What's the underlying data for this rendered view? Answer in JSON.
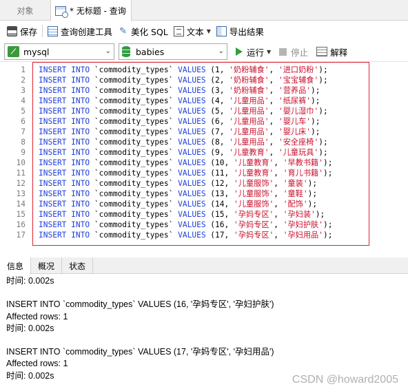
{
  "tabs": {
    "objects_label": "对象",
    "query_label": "* 无标题 - 查询"
  },
  "toolbar": {
    "save": "保存",
    "query_builder": "查询创建工具",
    "beautify_sql": "美化 SQL",
    "text": "文本",
    "export_results": "导出结果"
  },
  "connection": {
    "value": "mysql"
  },
  "database": {
    "value": "babies"
  },
  "actions": {
    "run": "运行",
    "stop": "停止",
    "explain": "解释"
  },
  "editor": {
    "lines": [
      {
        "n": "1",
        "kw1": "INSERT",
        "kw2": "INTO",
        "table": "`commodity_types`",
        "kw3": "VALUES",
        "id": "1",
        "a": "'奶粉辅食'",
        "b": "'进口奶粉'"
      },
      {
        "n": "2",
        "kw1": "INSERT",
        "kw2": "INTO",
        "table": "`commodity_types`",
        "kw3": "VALUES",
        "id": "2",
        "a": "'奶粉辅食'",
        "b": "'宝宝辅食'"
      },
      {
        "n": "3",
        "kw1": "INSERT",
        "kw2": "INTO",
        "table": "`commodity_types`",
        "kw3": "VALUES",
        "id": "3",
        "a": "'奶粉辅食'",
        "b": "'营养品'"
      },
      {
        "n": "4",
        "kw1": "INSERT",
        "kw2": "INTO",
        "table": "`commodity_types`",
        "kw3": "VALUES",
        "id": "4",
        "a": "'儿童用品'",
        "b": "'纸尿裤'"
      },
      {
        "n": "5",
        "kw1": "INSERT",
        "kw2": "INTO",
        "table": "`commodity_types`",
        "kw3": "VALUES",
        "id": "5",
        "a": "'儿童用品'",
        "b": "'婴儿湿巾'"
      },
      {
        "n": "6",
        "kw1": "INSERT",
        "kw2": "INTO",
        "table": "`commodity_types`",
        "kw3": "VALUES",
        "id": "6",
        "a": "'儿童用品'",
        "b": "'婴儿车'"
      },
      {
        "n": "7",
        "kw1": "INSERT",
        "kw2": "INTO",
        "table": "`commodity_types`",
        "kw3": "VALUES",
        "id": "7",
        "a": "'儿童用品'",
        "b": "'婴儿床'"
      },
      {
        "n": "8",
        "kw1": "INSERT",
        "kw2": "INTO",
        "table": "`commodity_types`",
        "kw3": "VALUES",
        "id": "8",
        "a": "'儿童用品'",
        "b": "'安全座椅'"
      },
      {
        "n": "9",
        "kw1": "INSERT",
        "kw2": "INTO",
        "table": "`commodity_types`",
        "kw3": "VALUES",
        "id": "9",
        "a": "'儿童教育'",
        "b": "'儿童玩具'"
      },
      {
        "n": "10",
        "kw1": "INSERT",
        "kw2": "INTO",
        "table": "`commodity_types`",
        "kw3": "VALUES",
        "id": "10",
        "a": "'儿童教育'",
        "b": "'早教书籍'"
      },
      {
        "n": "11",
        "kw1": "INSERT",
        "kw2": "INTO",
        "table": "`commodity_types`",
        "kw3": "VALUES",
        "id": "11",
        "a": "'儿童教育'",
        "b": "'育儿书籍'"
      },
      {
        "n": "12",
        "kw1": "INSERT",
        "kw2": "INTO",
        "table": "`commodity_types`",
        "kw3": "VALUES",
        "id": "12",
        "a": "'儿童服饰'",
        "b": "'童装'"
      },
      {
        "n": "13",
        "kw1": "INSERT",
        "kw2": "INTO",
        "table": "`commodity_types`",
        "kw3": "VALUES",
        "id": "13",
        "a": "'儿童服饰'",
        "b": "'童鞋'"
      },
      {
        "n": "14",
        "kw1": "INSERT",
        "kw2": "INTO",
        "table": "`commodity_types`",
        "kw3": "VALUES",
        "id": "14",
        "a": "'儿童服饰'",
        "b": "'配饰'"
      },
      {
        "n": "15",
        "kw1": "INSERT",
        "kw2": "INTO",
        "table": "`commodity_types`",
        "kw3": "VALUES",
        "id": "15",
        "a": "'孕妈专区'",
        "b": "'孕妇装'"
      },
      {
        "n": "16",
        "kw1": "INSERT",
        "kw2": "INTO",
        "table": "`commodity_types`",
        "kw3": "VALUES",
        "id": "16",
        "a": "'孕妈专区'",
        "b": "'孕妇护肤'"
      },
      {
        "n": "17",
        "kw1": "INSERT",
        "kw2": "INTO",
        "table": "`commodity_types`",
        "kw3": "VALUES",
        "id": "17",
        "a": "'孕妈专区'",
        "b": "'孕妇用品'"
      }
    ]
  },
  "result_tabs": [
    "信息",
    "概况",
    "状态"
  ],
  "messages": [
    "时间: 0.002s",
    "",
    "INSERT INTO `commodity_types` VALUES (16, '孕妈专区', '孕妇护肤')",
    "Affected rows: 1",
    "时间: 0.002s",
    "",
    "INSERT INTO `commodity_types` VALUES (17, '孕妈专区', '孕妇用品')",
    "Affected rows: 1",
    "时间: 0.002s"
  ],
  "watermark": "CSDN @howard2005"
}
